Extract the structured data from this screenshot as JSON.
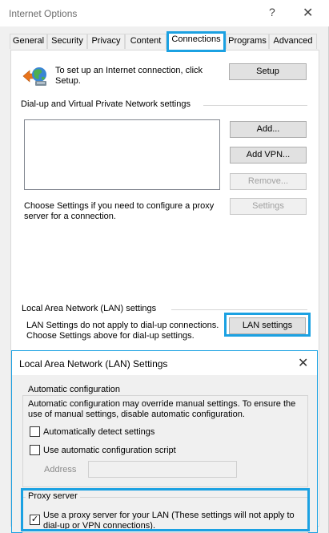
{
  "window": {
    "title": "Internet Options",
    "help_glyph": "?",
    "close_glyph": "✕"
  },
  "tabs": [
    {
      "label": "General"
    },
    {
      "label": "Security"
    },
    {
      "label": "Privacy"
    },
    {
      "label": "Content"
    },
    {
      "label": "Connections"
    },
    {
      "label": "Programs"
    },
    {
      "label": "Advanced"
    }
  ],
  "active_tab": "Connections",
  "setup": {
    "text": "To set up an Internet connection, click Setup.",
    "button": "Setup"
  },
  "dialup": {
    "heading": "Dial-up and Virtual Private Network settings",
    "add": "Add...",
    "add_vpn": "Add VPN...",
    "remove": "Remove...",
    "proxy_text": "Choose Settings if you need to configure a proxy server for a connection.",
    "settings": "Settings"
  },
  "lan": {
    "heading": "Local Area Network (LAN) settings",
    "text": "LAN Settings do not apply to dial-up connections. Choose Settings above for dial-up settings.",
    "button": "LAN settings"
  },
  "lan_dialog": {
    "title": "Local Area Network (LAN) Settings",
    "close_glyph": "✕",
    "auto_config": {
      "legend": "Automatic configuration",
      "description": "Automatic configuration may override manual settings.  To ensure the use of manual settings, disable automatic configuration.",
      "auto_detect": {
        "label": "Automatically detect settings",
        "checked": false
      },
      "auto_script": {
        "label": "Use automatic configuration script",
        "checked": false
      },
      "address_label": "Address",
      "address_value": ""
    },
    "proxy": {
      "legend": "Proxy server",
      "use_proxy": {
        "label": "Use a proxy server for your LAN (These settings will not apply to dial-up or VPN connections).",
        "checked": true,
        "mark": "✓"
      }
    }
  },
  "colors": {
    "highlight": "#1ba1e2",
    "window_bg": "#f0f0f0",
    "panel_bg": "#ffffff"
  },
  "icons": {
    "setup": "globe-network-icon"
  }
}
